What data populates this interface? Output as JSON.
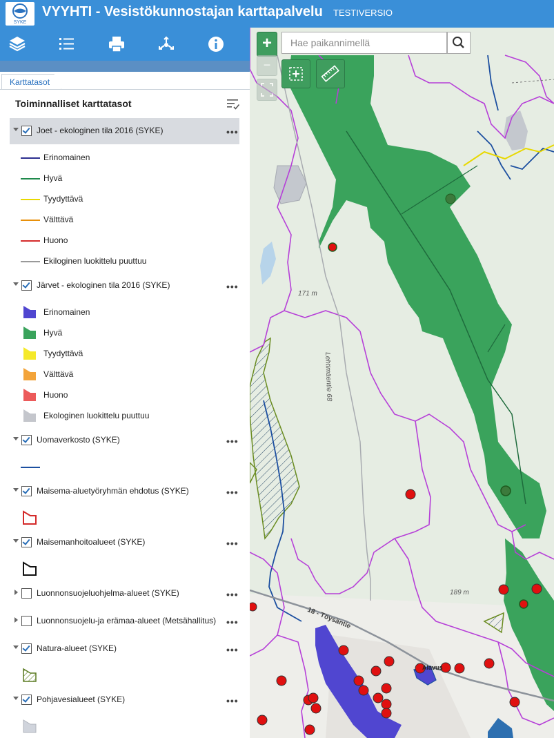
{
  "header": {
    "title": "VYYHTI - Vesistökunnostajan karttapalvelu",
    "badge": "TESTIVERSIO",
    "logo_text": "SYKE",
    "bg_color": "#3a8fd8"
  },
  "toolbar": {
    "icons": [
      "layers-icon",
      "list-icon",
      "print-icon",
      "share-icon",
      "info-icon"
    ]
  },
  "panel": {
    "tab_label": "Karttatasot",
    "section_title": "Toiminnalliset karttatasot",
    "more_label": "•••",
    "layers": [
      {
        "name": "Joet - ekologinen tila 2016 (SYKE)",
        "checked": true,
        "expanded": true,
        "legend_type": "line",
        "legend": [
          {
            "label": "Erinomainen",
            "color": "#2b2d8f"
          },
          {
            "label": "Hyvä",
            "color": "#1f8a4c"
          },
          {
            "label": "Tyydyttävä",
            "color": "#e8d800"
          },
          {
            "label": "Välttävä",
            "color": "#e8900a"
          },
          {
            "label": "Huono",
            "color": "#d42a2a"
          },
          {
            "label": "Ekiloginen luokittelu puuttuu",
            "color": "#999999"
          }
        ]
      },
      {
        "name": "Järvet - ekologinen tila 2016 (SYKE)",
        "checked": true,
        "expanded": true,
        "legend_type": "polygon",
        "legend": [
          {
            "label": "Erinomainen",
            "color": "#5046d0"
          },
          {
            "label": "Hyvä",
            "color": "#3aa35c"
          },
          {
            "label": "Tyydyttävä",
            "color": "#f5e92a"
          },
          {
            "label": "Välttävä",
            "color": "#f3a43a"
          },
          {
            "label": "Huono",
            "color": "#ec5a5a"
          },
          {
            "label": "Ekologinen luokittelu puuttuu",
            "color": "#c4c6cc"
          }
        ]
      },
      {
        "name": "Uomaverkosto (SYKE)",
        "checked": true,
        "expanded": true
      },
      {
        "name": "Maisema-aluetyöryhmän ehdotus (SYKE)",
        "checked": true,
        "expanded": true
      },
      {
        "name": "Maisemanhoitoalueet (SYKE)",
        "checked": true,
        "expanded": true
      },
      {
        "name": "Luonnonsuojeluohjelma-alueet (SYKE)",
        "checked": false,
        "expanded": false
      },
      {
        "name": "Luonnonsuojelu-ja erämaa-alueet (Metsähallitus)",
        "checked": false,
        "expanded": false
      },
      {
        "name": "Natura-alueet (SYKE)",
        "checked": true,
        "expanded": true
      },
      {
        "name": "Pohjavesialueet (SYKE)",
        "checked": true,
        "expanded": true
      }
    ]
  },
  "map": {
    "search_placeholder": "Hae paikannimellä",
    "search_value": "",
    "zoom_in_label": "+",
    "zoom_out_label": "−",
    "labels": {
      "elev1": "171 m",
      "elev2": "189 m",
      "road1": "Lehtimäentie 68",
      "road2": "18 - Töysäntie",
      "town": "Alavus"
    },
    "colors": {
      "forest_green": "#3aa35c",
      "boundary": "#b640d8",
      "sample_point": "#e01010",
      "lake_blue": "#5046d0"
    }
  }
}
